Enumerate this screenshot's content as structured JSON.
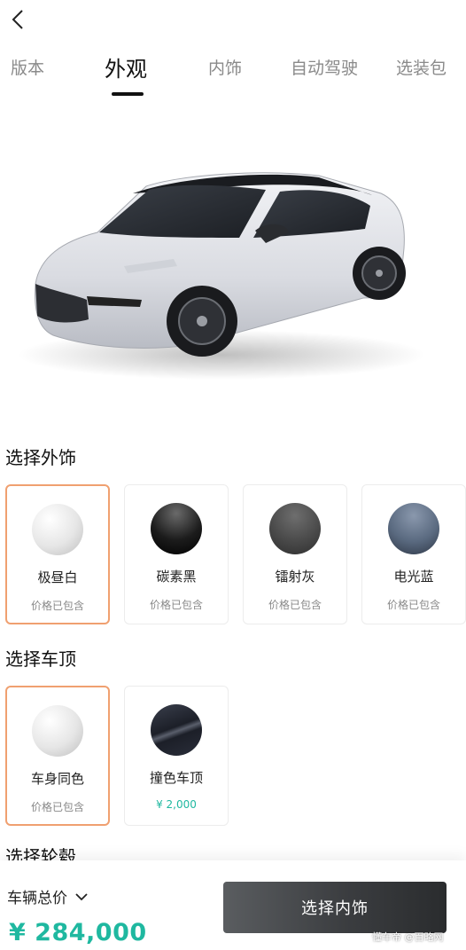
{
  "nav": {
    "back_icon": "chevron-left-icon",
    "tabs": [
      {
        "label": "版本",
        "active": false
      },
      {
        "label": "外观",
        "active": true
      },
      {
        "label": "内饰",
        "active": false
      },
      {
        "label": "自动驾驶",
        "active": false
      },
      {
        "label": "选装包",
        "active": false
      }
    ]
  },
  "exterior": {
    "title": "选择外饰",
    "options": [
      {
        "name": "极昼白",
        "price": "价格已包含",
        "selected": true,
        "color": "#e6e6e6"
      },
      {
        "name": "碳素黑",
        "price": "价格已包含",
        "selected": false,
        "color": "#1c1c1c"
      },
      {
        "name": "镭射灰",
        "price": "价格已包含",
        "selected": false,
        "color": "#4a4a4a"
      },
      {
        "name": "电光蓝",
        "price": "价格已包含",
        "selected": false,
        "color": "#5a6a80"
      }
    ]
  },
  "roof": {
    "title": "选择车顶",
    "options": [
      {
        "name": "车身同色",
        "price": "价格已包含",
        "selected": true,
        "color": "#e6e6e6"
      },
      {
        "name": "撞色车顶",
        "price": "¥ 2,000",
        "selected": false,
        "color": "#2a2e3a"
      }
    ]
  },
  "wheels": {
    "title": "选择轮毂"
  },
  "footer": {
    "total_label": "车辆总价",
    "total_price": "¥ 284,000",
    "cta_label": "选择内饰",
    "watermark": "懂车帝 @百略网"
  },
  "colors": {
    "accent": "#1fb8a0",
    "selected_border": "#f0a070"
  }
}
